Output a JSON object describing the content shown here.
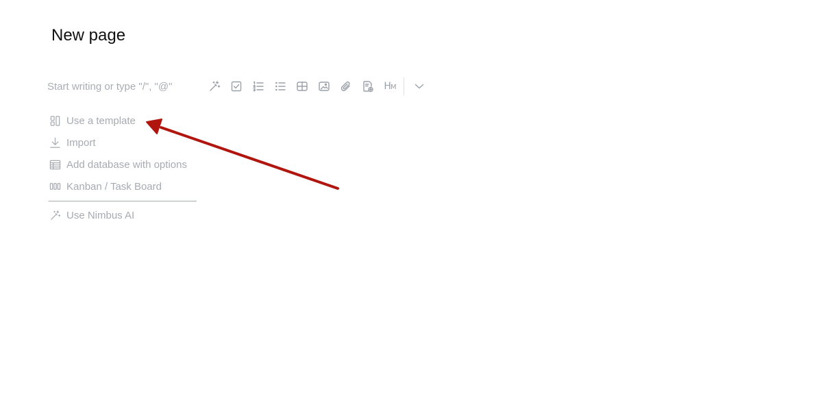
{
  "page": {
    "title": "New page"
  },
  "editor": {
    "placeholder": "Start writing or type \"/\", \"@\""
  },
  "toolbar": {
    "items": [
      {
        "icon": "magic-wand-icon"
      },
      {
        "icon": "checkbox-icon"
      },
      {
        "icon": "numbered-list-icon"
      },
      {
        "icon": "bulleted-list-icon"
      },
      {
        "icon": "table-icon"
      },
      {
        "icon": "image-icon"
      },
      {
        "icon": "attachment-icon"
      },
      {
        "icon": "add-page-icon"
      },
      {
        "icon": "heading-icon",
        "text_h": "H",
        "text_m": "M"
      },
      {
        "icon": "chevron-down-icon"
      }
    ]
  },
  "options": {
    "use_template": {
      "label": "Use a template",
      "icon": "template-icon"
    },
    "import": {
      "label": "Import",
      "icon": "import-icon"
    },
    "add_database": {
      "label": "Add database with options",
      "icon": "database-icon"
    },
    "kanban": {
      "label": "Kanban / Task Board",
      "icon": "kanban-icon"
    },
    "nimbus_ai": {
      "label": "Use Nimbus AI",
      "icon": "magic-wand-icon"
    }
  },
  "colors": {
    "title": "#111111",
    "muted": "#a6abb2",
    "annotation_arrow": "#b0160e"
  }
}
